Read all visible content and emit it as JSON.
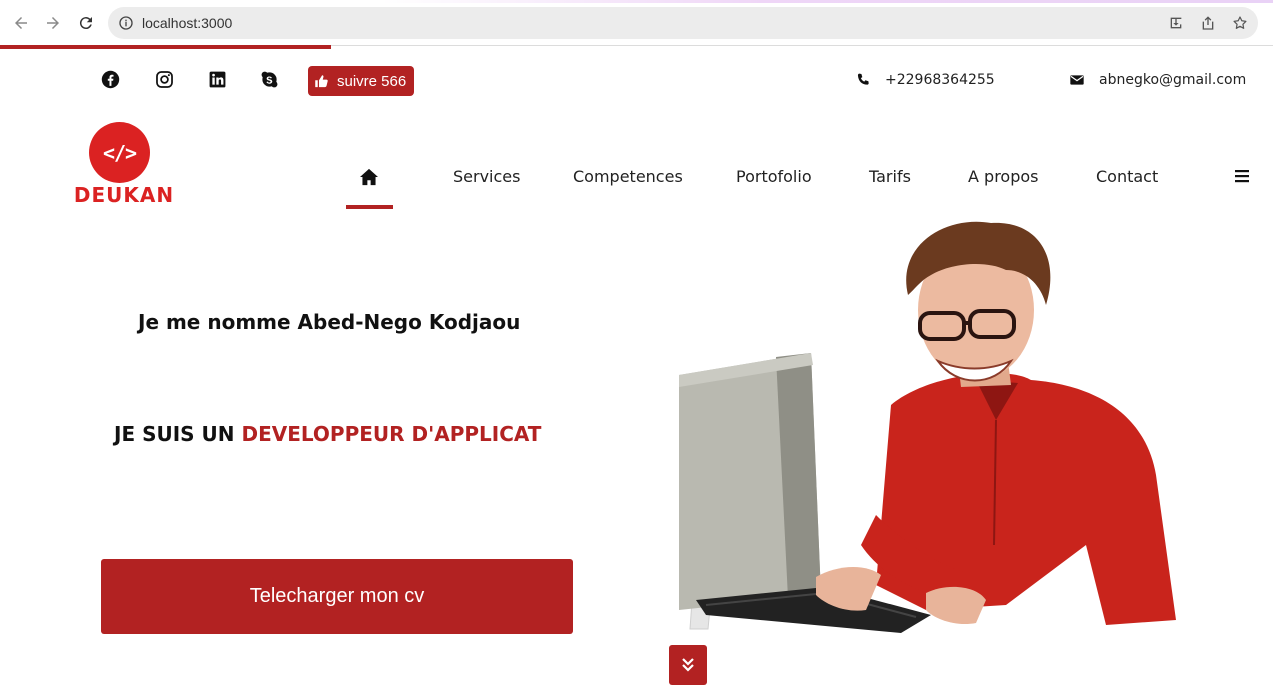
{
  "browser": {
    "url": "localhost:3000",
    "load_progress_percent": 26
  },
  "topbar": {
    "social_icons": [
      "facebook-icon",
      "instagram-icon",
      "linkedin-icon",
      "skype-icon"
    ],
    "follow_label": "suivre 566",
    "phone": "+22968364255",
    "email": "abnegko@gmail.com"
  },
  "brand": {
    "logo_symbol": "</>",
    "logo_text": "DEUKAN",
    "color": "#db2222"
  },
  "nav": {
    "home_icon": "home-icon",
    "items": [
      "Services",
      "Competences",
      "Portofolio",
      "Tarifs",
      "A propos",
      "Contact"
    ],
    "active": "home"
  },
  "hero": {
    "name_line": "Je me nomme Abed-Nego Kodjaou",
    "role_prefix": "JE SUIS UN",
    "role_accent": "DEVELOPPEUR D'APPLICAT",
    "cv_button": "Telecharger mon cv"
  },
  "colors": {
    "accent": "#b22222",
    "shirt": "#c9241c"
  }
}
